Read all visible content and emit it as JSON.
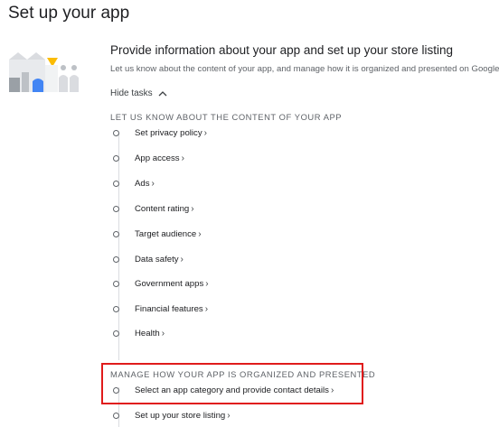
{
  "page": {
    "title": "Set up your app"
  },
  "section": {
    "title": "Provide information about your app and set up your store listing",
    "description": "Let us know about the content of your app, and manage how it is organized and presented on Google Play",
    "hide_tasks_label": "Hide tasks"
  },
  "groups": [
    {
      "heading": "LET US KNOW ABOUT THE CONTENT OF YOUR APP",
      "tasks": [
        {
          "label": "Set privacy policy"
        },
        {
          "label": "App access"
        },
        {
          "label": "Ads"
        },
        {
          "label": "Content rating"
        },
        {
          "label": "Target audience"
        },
        {
          "label": "Data safety"
        },
        {
          "label": "Government apps"
        },
        {
          "label": "Financial features"
        },
        {
          "label": "Health"
        }
      ]
    },
    {
      "heading": "MANAGE HOW YOUR APP IS ORGANIZED AND PRESENTED",
      "tasks": [
        {
          "label": "Select an app category and provide contact details"
        },
        {
          "label": "Set up your store listing"
        }
      ]
    }
  ],
  "icons": {
    "chevron_up": "chevron-up-icon",
    "chevron_right": "chevron-right-icon",
    "illustration": "setup-illustration-icon"
  },
  "colors": {
    "highlight_border": "#e01b1b",
    "illustration_blue": "#4285f4",
    "illustration_yellow": "#fbbc04",
    "illustration_gray": "#bdc1c6"
  }
}
